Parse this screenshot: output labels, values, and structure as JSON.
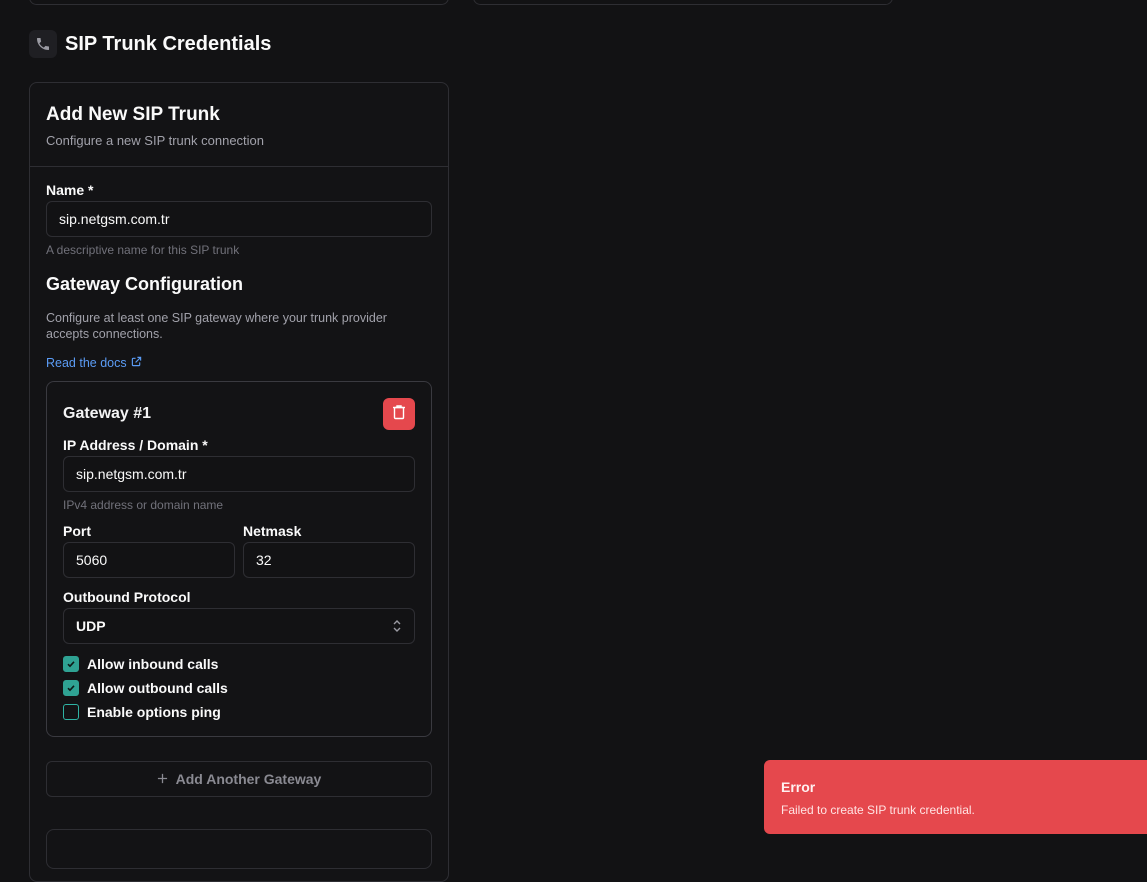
{
  "section": {
    "title": "SIP Trunk Credentials",
    "icon": "phone-icon"
  },
  "card": {
    "title": "Add New SIP Trunk",
    "description": "Configure a new SIP trunk connection"
  },
  "name_field": {
    "label": "Name *",
    "value": "sip.netgsm.com.tr",
    "hint": "A descriptive name for this SIP trunk"
  },
  "gateway_config": {
    "title": "Gateway Configuration",
    "description": "Configure at least one SIP gateway where your trunk provider accepts connections.",
    "docs_link": "Read the docs"
  },
  "gateway": {
    "title": "Gateway #1",
    "ip_label": "IP Address / Domain *",
    "ip_value": "sip.netgsm.com.tr",
    "ip_hint": "IPv4 address or domain name",
    "port_label": "Port",
    "port_value": "5060",
    "netmask_label": "Netmask",
    "netmask_value": "32",
    "protocol_label": "Outbound Protocol",
    "protocol_value": "UDP",
    "checkboxes": [
      {
        "label": "Allow inbound calls",
        "checked": true
      },
      {
        "label": "Allow outbound calls",
        "checked": true
      },
      {
        "label": "Enable options ping",
        "checked": false
      }
    ]
  },
  "add_gateway_label": "Add Another Gateway",
  "toast": {
    "title": "Error",
    "message": "Failed to create SIP trunk credential."
  },
  "colors": {
    "accent_link": "#5b9cf5",
    "danger": "#e5484d",
    "checkbox": "#2fa293"
  }
}
